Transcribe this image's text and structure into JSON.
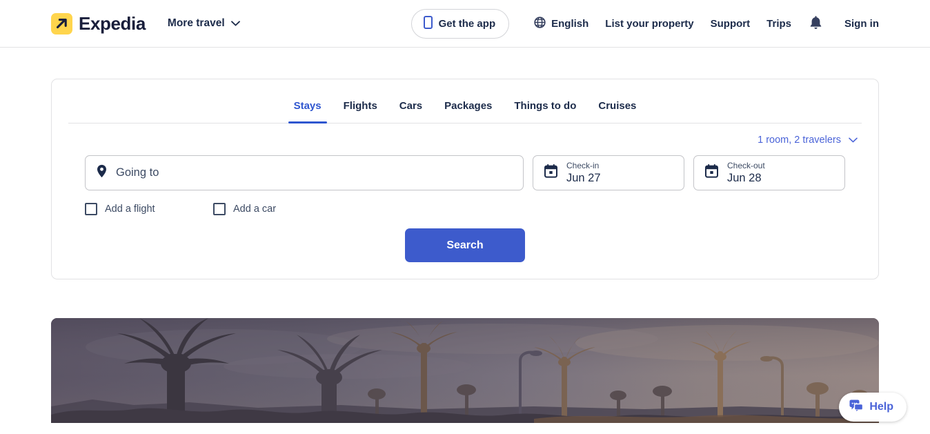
{
  "header": {
    "brand_name": "Expedia",
    "brand_icon": "expedia-arrow-logo",
    "more_travel": {
      "label": "More travel",
      "icon": "chevron-down-icon"
    },
    "get_app": {
      "label": "Get the app",
      "icon": "mobile-phone-icon"
    },
    "language": {
      "label": "English",
      "icon": "globe-icon"
    },
    "list_property_label": "List your property",
    "support_label": "Support",
    "trips_label": "Trips",
    "notifications_icon": "bell-icon",
    "sign_in_label": "Sign in"
  },
  "search": {
    "tabs": [
      {
        "label": "Stays",
        "active": true
      },
      {
        "label": "Flights",
        "active": false
      },
      {
        "label": "Cars",
        "active": false
      },
      {
        "label": "Packages",
        "active": false
      },
      {
        "label": "Things to do",
        "active": false
      },
      {
        "label": "Cruises",
        "active": false
      }
    ],
    "travelers": {
      "label": "1 room, 2 travelers",
      "icon": "chevron-down-icon"
    },
    "destination": {
      "icon": "location-pin-icon",
      "placeholder": "Going to",
      "value": ""
    },
    "check_in": {
      "icon": "calendar-icon",
      "label": "Check-in",
      "value": "Jun 27"
    },
    "check_out": {
      "icon": "calendar-icon",
      "label": "Check-out",
      "value": "Jun 28"
    },
    "options": [
      {
        "label": "Add a flight",
        "checked": false
      },
      {
        "label": "Add a car",
        "checked": false
      }
    ],
    "submit_label": "Search"
  },
  "hero": {
    "alt": "palm trees at dusk"
  },
  "help": {
    "label": "Help",
    "icon": "chat-bubble-icon"
  },
  "colors": {
    "accent_blue": "#3d5bcc",
    "link_blue": "#4a63d8",
    "tab_active": "#2f56cf",
    "brand_yellow": "#ffd54d",
    "text_navy": "#1c2b4a",
    "border_gray": "#e2e2e4"
  }
}
